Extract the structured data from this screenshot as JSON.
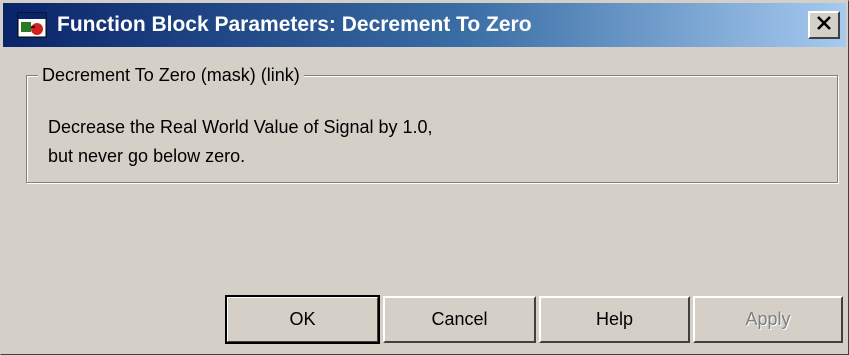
{
  "window": {
    "title": "Function Block Parameters: Decrement To Zero",
    "close_glyph": "✕",
    "icon": "simulink-block-icon"
  },
  "group": {
    "legend": "Decrement To Zero (mask) (link)",
    "description_lines": [
      "Decrease the Real World Value of Signal by 1.0,",
      "but never go below zero."
    ]
  },
  "buttons": {
    "ok": "OK",
    "cancel": "Cancel",
    "help": "Help",
    "apply": "Apply"
  },
  "colors": {
    "titlebar_start": "#0a246a",
    "titlebar_end": "#a6caf0",
    "dialog_bg": "#d4d0c8",
    "disabled_text": "#808080"
  }
}
